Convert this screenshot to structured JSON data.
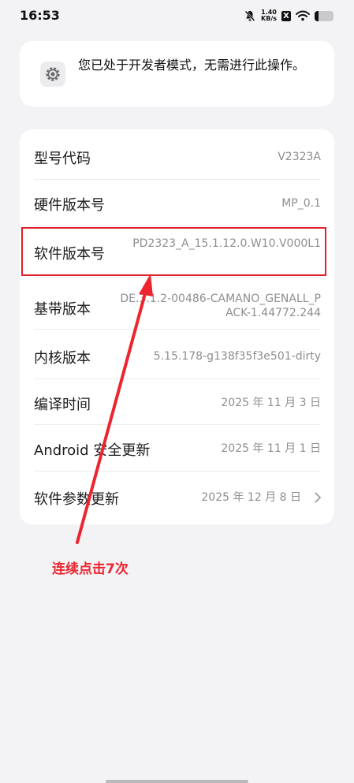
{
  "status_bar": {
    "time": "16:53",
    "net_speed_value": "1.40",
    "net_speed_unit": "KB/s",
    "sim_icon": "X",
    "battery_level": 0.2
  },
  "toast": {
    "icon": "settings-icon",
    "text": "您已处于开发者模式，无需进行此操作。"
  },
  "info": {
    "rows": [
      {
        "label": "型号代码",
        "value": "V2323A"
      },
      {
        "label": "硬件版本号",
        "value": "MP_0.1"
      },
      {
        "label": "软件版本号",
        "value": "PD2323_A_15.1.12.0.W10.V000L1"
      },
      {
        "label": "基带版本",
        "value": "DE.3.1.2-00486-CAMANO_GENALL_PACK-1.44772.244"
      },
      {
        "label": "内核版本",
        "value": "5.15.178-g138f35f3e501-dirty"
      },
      {
        "label": "编译时间",
        "value": "2025 年 11 月 3 日"
      },
      {
        "label": "Android 安全更新",
        "value": "2025 年 11 月 1 日"
      },
      {
        "label": "软件参数更新",
        "value": "2025 年 12 月 8 日"
      }
    ]
  },
  "annotation": {
    "text": "连续点击7次",
    "color": "#ec2530"
  }
}
